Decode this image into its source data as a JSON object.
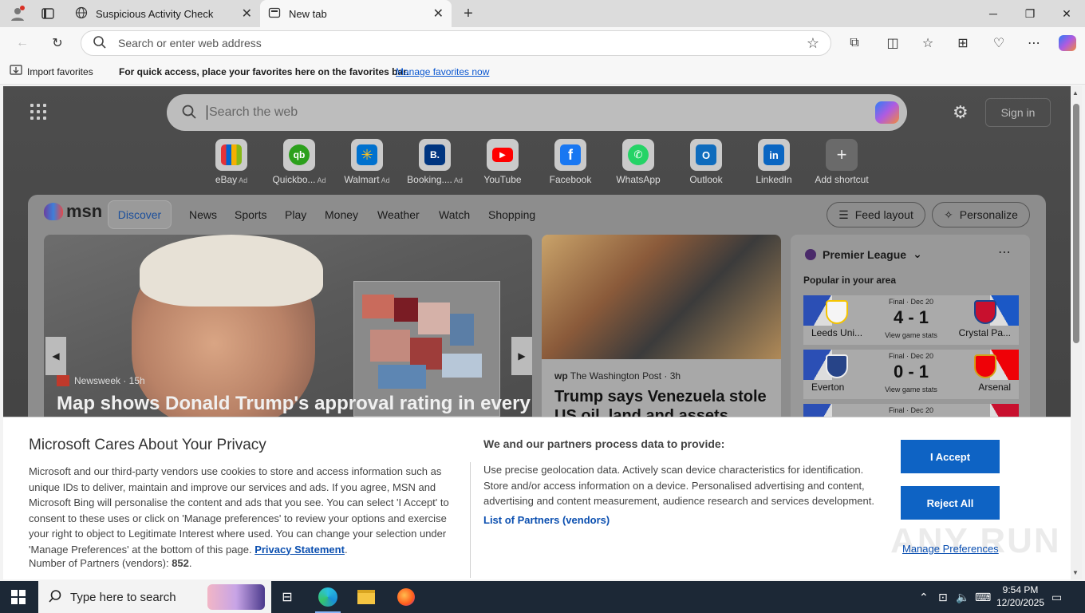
{
  "browser": {
    "tabs": [
      {
        "title": "Suspicious Activity Check",
        "active": false
      },
      {
        "title": "New tab",
        "active": true
      }
    ],
    "address_placeholder": "Search or enter web address",
    "favorites_bar": {
      "import": "Import favorites",
      "hint": "For quick access, place your favorites here on the favorites bar.",
      "manage": "Manage favorites now"
    }
  },
  "newtab": {
    "search_placeholder": "Search the web",
    "sign_in": "Sign in",
    "shortcuts": [
      {
        "label": "eBay",
        "ad": "Ad",
        "color": "#ffffff"
      },
      {
        "label": "Quickbo...",
        "ad": "Ad",
        "color": "#2ca01c"
      },
      {
        "label": "Walmart",
        "ad": "Ad",
        "color": "#0071ce"
      },
      {
        "label": "Booking....",
        "ad": "Ad",
        "color": "#003580"
      },
      {
        "label": "YouTube",
        "ad": "",
        "color": "#ff0000"
      },
      {
        "label": "Facebook",
        "ad": "",
        "color": "#1877f2"
      },
      {
        "label": "WhatsApp",
        "ad": "",
        "color": "#25d366"
      },
      {
        "label": "Outlook",
        "ad": "",
        "color": "#0f6cbd"
      },
      {
        "label": "LinkedIn",
        "ad": "",
        "color": "#0a66c2"
      },
      {
        "label": "Add shortcut",
        "ad": "",
        "color": "#dddddd"
      }
    ]
  },
  "msn": {
    "logo": "msn",
    "nav": [
      "Discover",
      "News",
      "Sports",
      "Play",
      "Money",
      "Weather",
      "Watch",
      "Shopping"
    ],
    "feed_layout": "Feed layout",
    "personalize": "Personalize",
    "hero": {
      "source": "Newsweek · 15h",
      "headline": "Map shows Donald Trump's approval rating in every"
    },
    "story2": {
      "source": "The Washington Post · 3h",
      "headline": "Trump says Venezuela stole US oil, land and assets. Here's"
    },
    "sports": {
      "league": "Premier League",
      "popular": "Popular in your area",
      "matches": [
        {
          "status": "Final · Dec 20",
          "home": "Leeds Uni...",
          "away": "Crystal Pa...",
          "score": "4 - 1",
          "stats": "View game stats"
        },
        {
          "status": "Final · Dec 20",
          "home": "Everton",
          "away": "Arsenal",
          "score": "0 - 1",
          "stats": "View game stats"
        },
        {
          "status": "Final · Dec 20",
          "home": "",
          "away": "",
          "score": "",
          "stats": ""
        }
      ]
    }
  },
  "privacy": {
    "title": "Microsoft Cares About Your Privacy",
    "body": "Microsoft and our third-party vendors use cookies to store and access information such as unique IDs to deliver, maintain and improve our services and ads. If you agree, MSN and Microsoft Bing will personalise the content and ads that you see. You can select 'I Accept' to consent to these uses or click on 'Manage preferences' to review your options and exercise your right to object to Legitimate Interest where used.  You can change your selection under 'Manage Preferences' at the bottom of this page.",
    "privacy_link": "Privacy Statement",
    "partners_label": "Number of Partners (vendors):",
    "partners_count": "852",
    "subtitle": "We and our partners process data to provide:",
    "purposes": "Use precise geolocation data. Actively scan device characteristics for identification. Store and/or access information on a device. Personalised advertising and content, advertising and content measurement, audience research and services development.",
    "partners_link": "List of Partners (vendors)",
    "accept": "I Accept",
    "reject": "Reject All",
    "manage": "Manage Preferences",
    "watermark": "ANY RUN"
  },
  "taskbar": {
    "search_placeholder": "Type here to search",
    "time": "9:54 PM",
    "date": "12/20/2025"
  }
}
